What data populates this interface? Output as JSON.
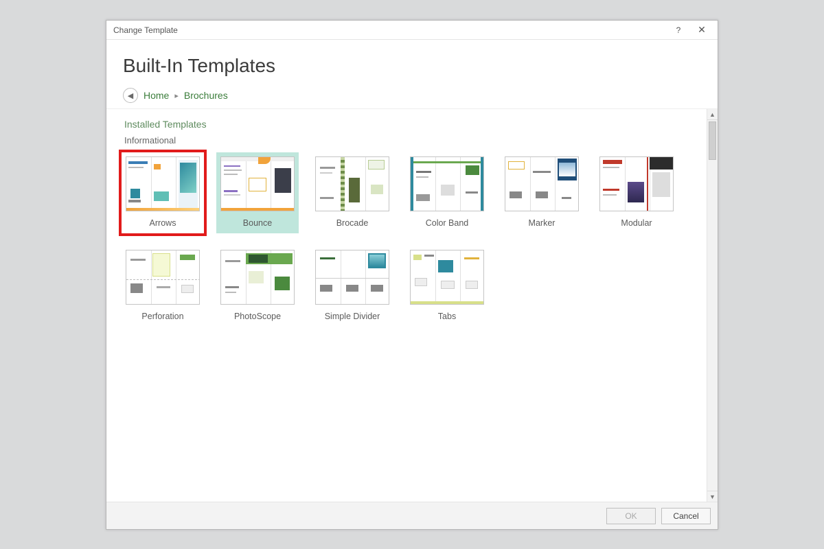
{
  "dialog": {
    "title": "Change Template"
  },
  "header": {
    "page_title": "Built-In Templates",
    "breadcrumb": {
      "home": "Home",
      "current": "Brochures"
    }
  },
  "content": {
    "installed_label": "Installed Templates",
    "category_label": "Informational",
    "templates": [
      {
        "label": "Arrows",
        "highlight": true,
        "selected": false
      },
      {
        "label": "Bounce",
        "highlight": false,
        "selected": true
      },
      {
        "label": "Brocade",
        "highlight": false,
        "selected": false
      },
      {
        "label": "Color Band",
        "highlight": false,
        "selected": false
      },
      {
        "label": "Marker",
        "highlight": false,
        "selected": false
      },
      {
        "label": "Modular",
        "highlight": false,
        "selected": false
      },
      {
        "label": "Perforation",
        "highlight": false,
        "selected": false
      },
      {
        "label": "PhotoScope",
        "highlight": false,
        "selected": false
      },
      {
        "label": "Simple Divider",
        "highlight": false,
        "selected": false
      },
      {
        "label": "Tabs",
        "highlight": false,
        "selected": false
      }
    ]
  },
  "footer": {
    "ok_label": "OK",
    "cancel_label": "Cancel",
    "ok_enabled": false
  }
}
